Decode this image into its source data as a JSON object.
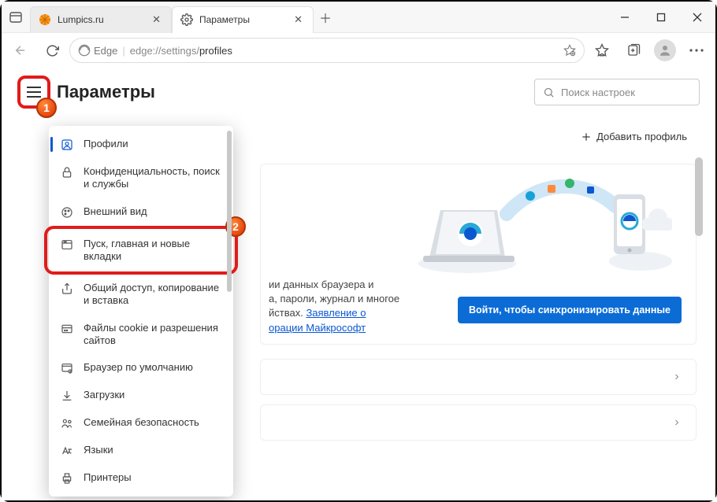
{
  "tabs": [
    {
      "label": "Lumpics.ru"
    },
    {
      "label": "Параметры"
    }
  ],
  "addr": {
    "brand": "Edge",
    "url_prefix": "edge://settings/",
    "url_page": "profiles"
  },
  "page": {
    "title": "Параметры",
    "search_placeholder": "Поиск настроек",
    "add_profile": "Добавить профиль"
  },
  "sidebar": {
    "items": [
      {
        "label": "Профили"
      },
      {
        "label": "Конфиденциальность, поиск и службы"
      },
      {
        "label": "Внешний вид"
      },
      {
        "label": "Пуск, главная и новые вкладки"
      },
      {
        "label": "Общий доступ, копирование и вставка"
      },
      {
        "label": "Файлы cookie и разрешения сайтов"
      },
      {
        "label": "Браузер по умолчанию"
      },
      {
        "label": "Загрузки"
      },
      {
        "label": "Семейная безопасность"
      },
      {
        "label": "Языки"
      },
      {
        "label": "Принтеры"
      }
    ]
  },
  "promo": {
    "text1": "ии данных браузера и",
    "text2": "а, пароли, журнал и многое",
    "text3": "йствах. ",
    "link1": "Заявление о",
    "link2": "орации Майкрософт",
    "button": "Войти, чтобы синхронизировать данные"
  },
  "annot": {
    "b1": "1",
    "b2": "2"
  }
}
